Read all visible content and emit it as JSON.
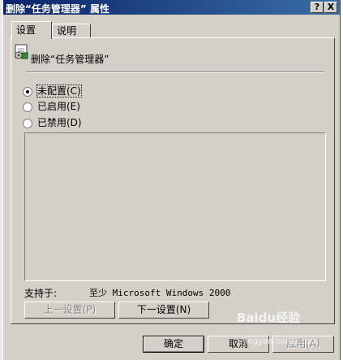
{
  "window": {
    "title": "删除“任务管理器” 属性",
    "buttons": {
      "help": "?",
      "close": "X"
    }
  },
  "tabs": [
    {
      "label": "设置",
      "active": true
    },
    {
      "label": "说明",
      "active": false
    }
  ],
  "policy": {
    "name": "删除“任务管理器”",
    "icon": "policy-setting-icon"
  },
  "options": [
    {
      "label": "未配置(C)",
      "checked": true
    },
    {
      "label": "已启用(E)",
      "checked": false
    },
    {
      "label": "已禁用(D)",
      "checked": false
    }
  ],
  "support": {
    "label": "支持于:",
    "value": "至少 Microsoft Windows 2000"
  },
  "nav": {
    "prev_label": "上一设置(P)",
    "next_label": "下一设置(N)"
  },
  "footer": {
    "ok_label": "确定",
    "cancel_label": "取消",
    "apply_label": "应用(A)"
  },
  "watermark": {
    "logo": "Baidu经验",
    "url": "jingyan.baidu.com"
  },
  "colors": {
    "title_bar": "#0a246a",
    "face": "#d4d0c8"
  }
}
